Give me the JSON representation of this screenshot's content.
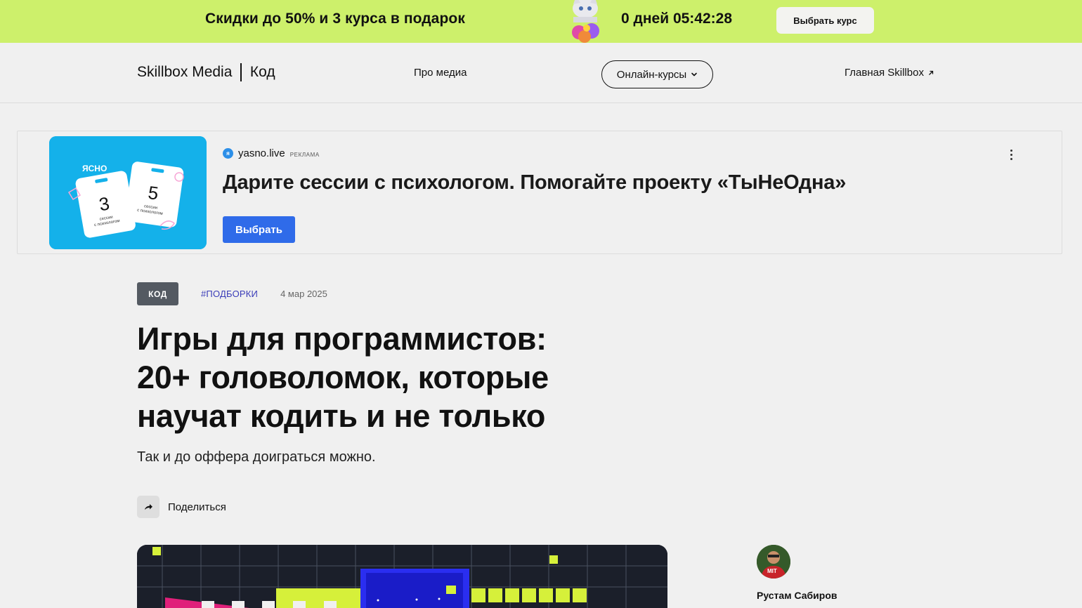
{
  "promo": {
    "text": "Скидки до 50% и 3 курса в подарок",
    "timer": "0 дней 05:42:28",
    "button_label": "Выбрать курс",
    "background": "#cdf06b"
  },
  "header": {
    "brand": "Skillbox Media",
    "section": "Код",
    "nav": {
      "about": "Про медиа",
      "courses": "Онлайн-курсы",
      "main": "Главная Skillbox"
    }
  },
  "ad": {
    "source": "yasno.live",
    "label": "РЕКЛАМА",
    "title": "Дарите сессии с психологом. Помогайте проекту «ТыНеОдна»",
    "button_label": "Выбрать",
    "image": {
      "brand": "ЯСНО",
      "card_left_number": "3",
      "card_right_number": "5",
      "card_caption_1": "сессии",
      "card_caption_2": "с психологом"
    },
    "accent": "#2f6be9"
  },
  "article": {
    "tag": "КОД",
    "hashtag": "#ПОДБОРКИ",
    "date": "4 мар 2025",
    "title_lines": [
      "Игры для программистов:",
      "20+ головоломок, которые",
      "научат кодить и не только"
    ],
    "subtitle": "Так и до оффера доиграться можно.",
    "share_label": "Поделиться"
  },
  "author": {
    "name": "Рустам Сабиров",
    "avatar_text": "MIT"
  }
}
